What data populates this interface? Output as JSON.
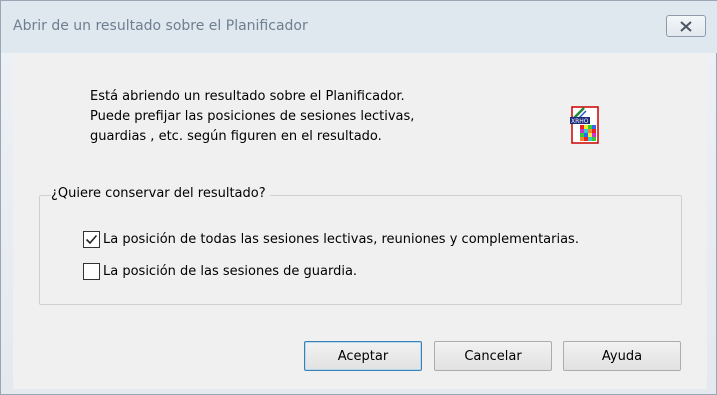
{
  "dialog": {
    "title": "Abrir de un resultado sobre el Planificador",
    "message_lines": [
      "Está abriendo un resultado sobre el Planificador.",
      "Puede prefijar las posiciones de sesiones lectivas,",
      "guardias , etc. según figuren en el resultado."
    ],
    "icon": {
      "name": "xrho-document-icon",
      "label": "XRHO"
    },
    "close_icon": "close-icon"
  },
  "options": {
    "group_label": "¿Quiere conservar del resultado?",
    "items": [
      {
        "label": "La posición de todas las sesiones lectivas, reuniones y complementarias.",
        "checked": true
      },
      {
        "label": "La posición de las sesiones de guardia.",
        "checked": false
      }
    ]
  },
  "buttons": {
    "accept": "Aceptar",
    "cancel": "Cancelar",
    "help": "Ayuda"
  }
}
